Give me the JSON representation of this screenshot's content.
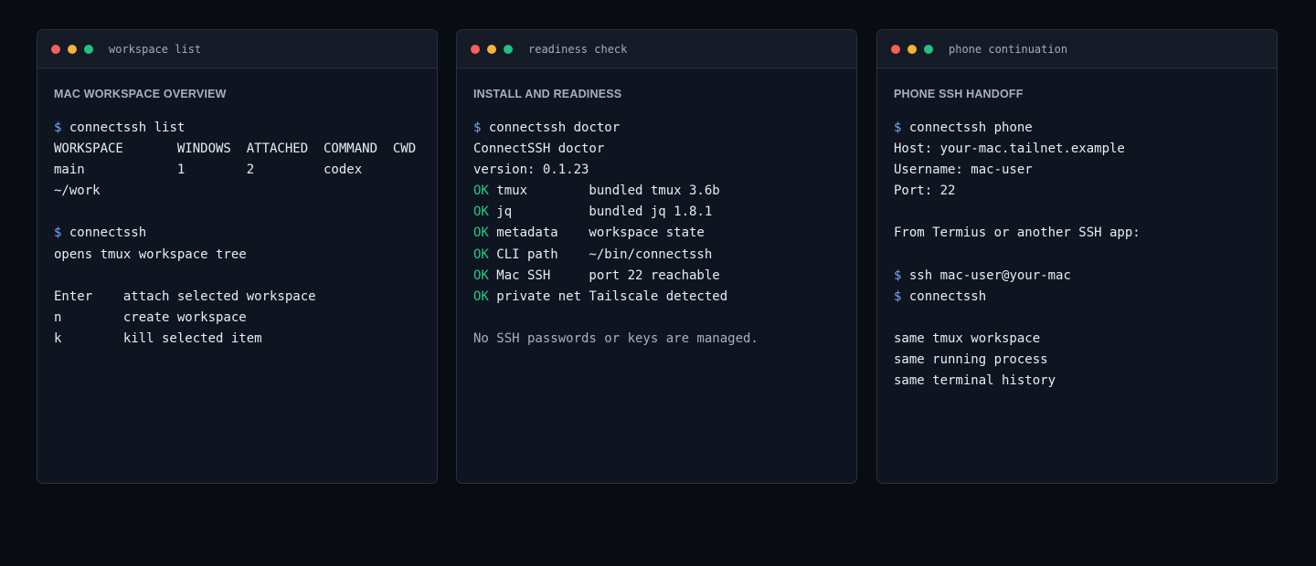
{
  "panels": [
    {
      "window_title": "workspace list",
      "heading": "MAC WORKSPACE OVERVIEW",
      "lines": [
        {
          "kind": "cmd",
          "prompt": "$",
          "text": " connectssh list"
        },
        {
          "kind": "out",
          "text": "WORKSPACE       WINDOWS  ATTACHED  COMMAND  CWD"
        },
        {
          "kind": "out",
          "text": "main            1        2         codex"
        },
        {
          "kind": "out",
          "text": "~/work"
        },
        {
          "kind": "blank",
          "text": ""
        },
        {
          "kind": "cmd",
          "prompt": "$",
          "text": " connectssh"
        },
        {
          "kind": "out",
          "text": "opens tmux workspace tree"
        },
        {
          "kind": "blank",
          "text": ""
        },
        {
          "kind": "out",
          "text": "Enter    attach selected workspace"
        },
        {
          "kind": "out",
          "text": "n        create workspace"
        },
        {
          "kind": "out",
          "text": "k        kill selected item"
        }
      ]
    },
    {
      "window_title": "readiness check",
      "heading": "INSTALL AND READINESS",
      "lines": [
        {
          "kind": "cmd",
          "prompt": "$",
          "text": " connectssh doctor"
        },
        {
          "kind": "out",
          "text": "ConnectSSH doctor"
        },
        {
          "kind": "out",
          "text": "version: 0.1.23"
        },
        {
          "kind": "ok",
          "status": "OK",
          "text": " tmux        bundled tmux 3.6b"
        },
        {
          "kind": "ok",
          "status": "OK",
          "text": " jq          bundled jq 1.8.1"
        },
        {
          "kind": "ok",
          "status": "OK",
          "text": " metadata    workspace state"
        },
        {
          "kind": "ok",
          "status": "OK",
          "text": " CLI path    ~/bin/connectssh"
        },
        {
          "kind": "ok",
          "status": "OK",
          "text": " Mac SSH     port 22 reachable"
        },
        {
          "kind": "ok",
          "status": "OK",
          "text": " private net Tailscale detected"
        },
        {
          "kind": "blank",
          "text": ""
        },
        {
          "kind": "muted",
          "text": "No SSH passwords or keys are managed."
        }
      ]
    },
    {
      "window_title": "phone continuation",
      "heading": "PHONE SSH HANDOFF",
      "lines": [
        {
          "kind": "cmd",
          "prompt": "$",
          "text": " connectssh phone"
        },
        {
          "kind": "out",
          "text": "Host: your-mac.tailnet.example"
        },
        {
          "kind": "out",
          "text": "Username: mac-user"
        },
        {
          "kind": "out",
          "text": "Port: 22"
        },
        {
          "kind": "blank",
          "text": ""
        },
        {
          "kind": "out",
          "text": "From Termius or another SSH app:"
        },
        {
          "kind": "blank",
          "text": ""
        },
        {
          "kind": "cmd",
          "prompt": "$",
          "text": " ssh mac-user@your-mac"
        },
        {
          "kind": "cmd",
          "prompt": "$",
          "text": " connectssh"
        },
        {
          "kind": "blank",
          "text": ""
        },
        {
          "kind": "out",
          "text": "same tmux workspace"
        },
        {
          "kind": "out",
          "text": "same running process"
        },
        {
          "kind": "out",
          "text": "same terminal history"
        }
      ]
    }
  ]
}
